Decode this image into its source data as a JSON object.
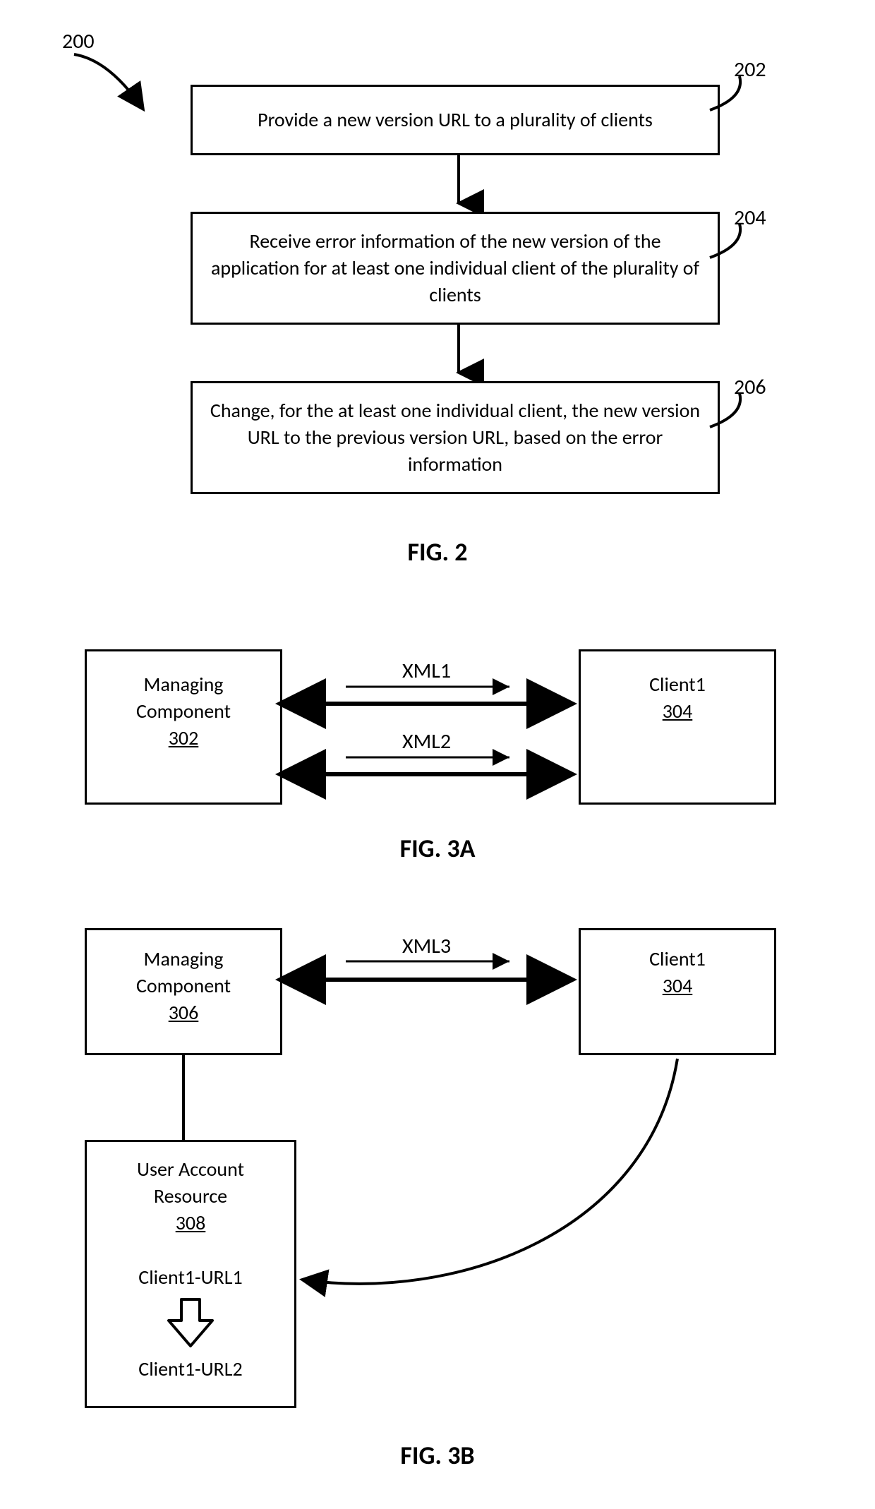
{
  "fig2": {
    "numLabel": "200",
    "step1": {
      "num": "202",
      "text": "Provide a new version URL to a plurality of clients"
    },
    "step2": {
      "num": "204",
      "text": "Receive error information of the new version of the application for at least one individual client of the plurality of clients"
    },
    "step3": {
      "num": "206",
      "text": "Change, for the at least one individual client, the new version URL to the previous version URL, based on the error information"
    },
    "caption": "FIG. 2"
  },
  "fig3a": {
    "managing": {
      "title": "Managing Component",
      "num": "302"
    },
    "client": {
      "title": "Client1",
      "num": "304"
    },
    "xml1": "XML1",
    "xml2": "XML2",
    "caption": "FIG. 3A"
  },
  "fig3b": {
    "managing": {
      "title": "Managing Component",
      "num": "306"
    },
    "client": {
      "title": "Client1",
      "num": "304"
    },
    "xml3": "XML3",
    "uar": {
      "title": "User Account Resource",
      "num": "308",
      "url1": "Client1-URL1",
      "url2": "Client1-URL2"
    },
    "caption": "FIG. 3B"
  }
}
